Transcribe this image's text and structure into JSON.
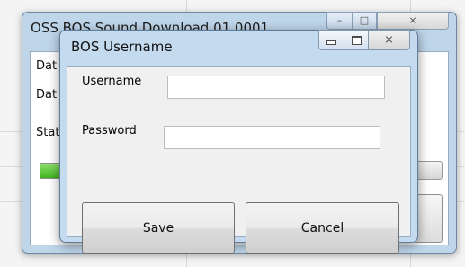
{
  "parent_window": {
    "title": "OSS BOS Sound Download 01.0001",
    "labels": [
      "Dat",
      "Dat",
      "Stat"
    ]
  },
  "dialog": {
    "title": "BOS Username",
    "controls": {
      "minimize_icon": "minimize-icon",
      "maximize_icon": "maximize-icon",
      "close_icon": "close-icon",
      "close_glyph": "⨯"
    },
    "username": {
      "label": "Username",
      "value": ""
    },
    "password": {
      "label": "Password",
      "value": ""
    },
    "save_label": "Save",
    "cancel_label": "Cancel"
  },
  "colors": {
    "title_bar": "#c4daee",
    "progress_fill": "#3fb51f"
  }
}
